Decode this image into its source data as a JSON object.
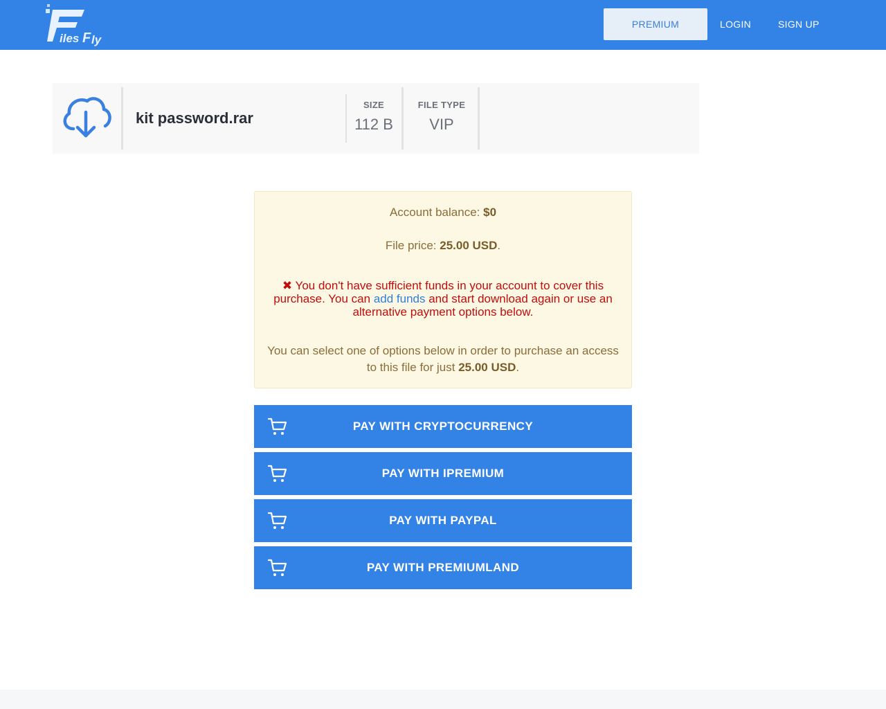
{
  "brand": {
    "logo_text": "FilesFly",
    "primary_color": "#3382e5",
    "warning_bg": "#fcf8e3",
    "error_color": "#c00d0d"
  },
  "nav": {
    "premium_label": "PREMIUM",
    "login_label": "LOGIN",
    "signup_label": "SIGN UP"
  },
  "file": {
    "icon": "cloud-download-icon",
    "name": "kit password.rar",
    "size_label": "SIZE",
    "size_value": "112 B",
    "type_label": "FILE TYPE",
    "type_value": "VIP"
  },
  "notice": {
    "balance_label": "Account balance: ",
    "balance_value": "$0",
    "price_label": "File price: ",
    "price_value": "25.00 USD",
    "price_suffix": ".",
    "error_icon": "✖",
    "error_before_link": " You don't have sufficient funds in your account to cover this purchase. You can ",
    "error_link": "add funds",
    "error_after_link": " and start download again or use an alternative payment options below.",
    "info_text": "You can select one of options below in order to purchase an access to this file for just ",
    "info_price": "25.00 USD",
    "info_suffix": "."
  },
  "payments": [
    {
      "label": "PAY WITH CRYPTOCURRENCY",
      "icon": "cart-icon"
    },
    {
      "label": "PAY WITH IPREMIUM",
      "icon": "cart-icon"
    },
    {
      "label": "PAY WITH PAYPAL",
      "icon": "cart-icon"
    },
    {
      "label": "PAY WITH PREMIUMLAND",
      "icon": "cart-icon"
    }
  ]
}
